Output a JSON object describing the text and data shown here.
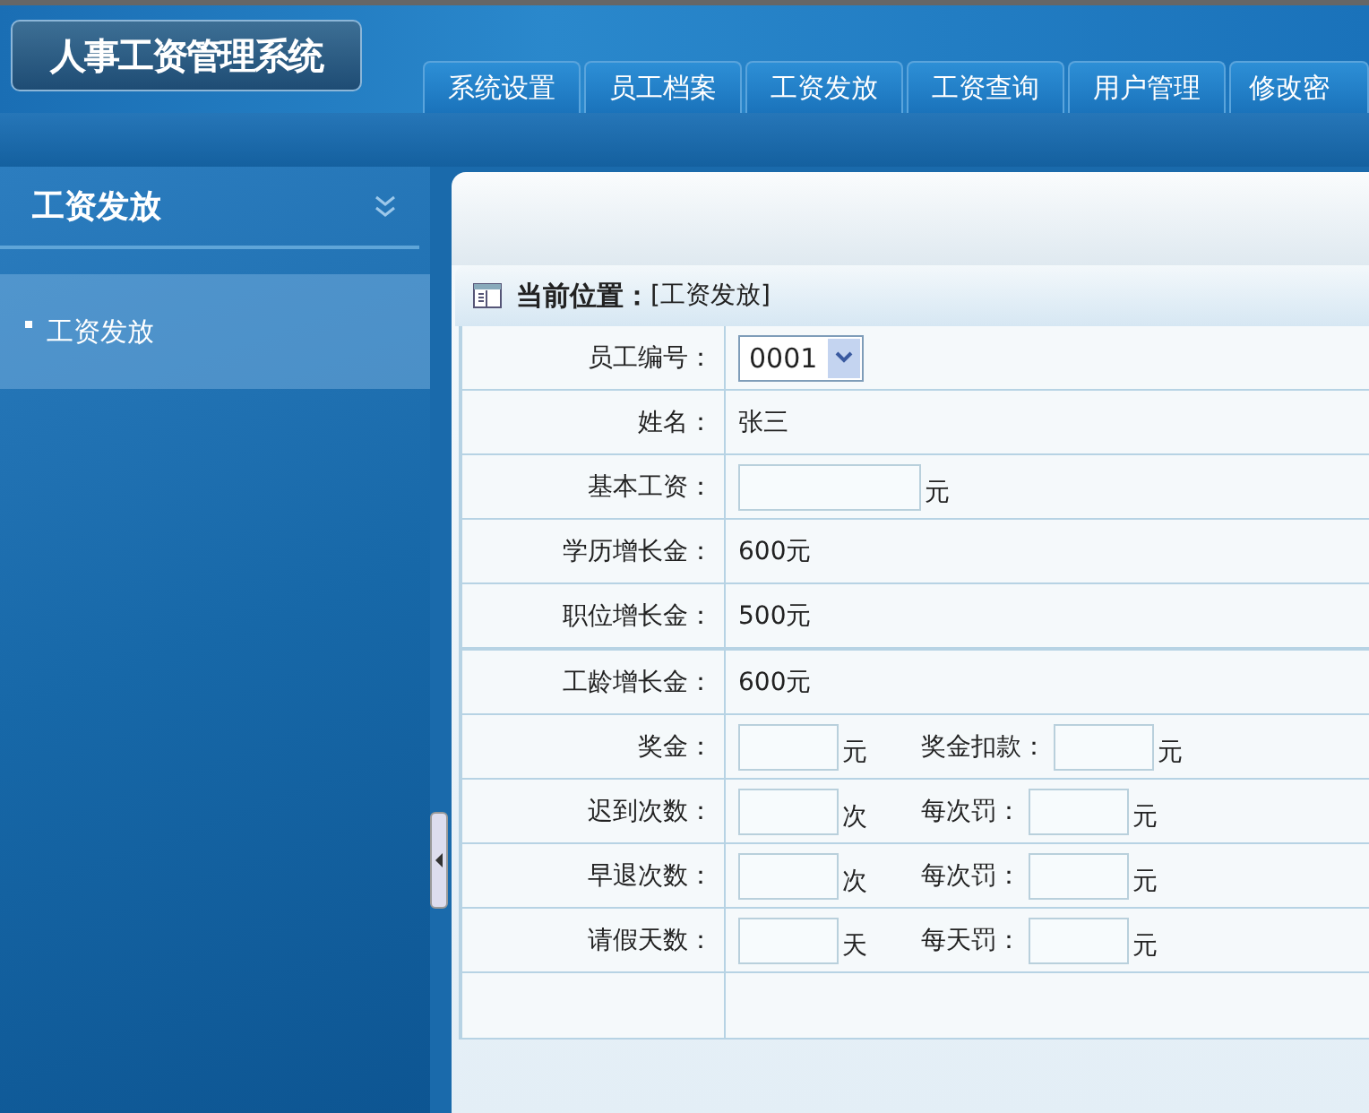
{
  "header": {
    "logo": "人事工资管理系统"
  },
  "tabs": [
    {
      "label": "系统设置",
      "selected": false
    },
    {
      "label": "员工档案",
      "selected": false
    },
    {
      "label": "工资发放",
      "selected": false
    },
    {
      "label": "工资查询",
      "selected": false
    },
    {
      "label": "用户管理",
      "selected": false
    },
    {
      "label": "修改密",
      "selected": false
    }
  ],
  "sidebar": {
    "title": "工资发放",
    "items": [
      {
        "label": "工资发放",
        "selected": true
      }
    ]
  },
  "breadcrumb": {
    "label": "当前位置：",
    "value": "[工资发放]"
  },
  "form": {
    "rows": [
      {
        "kind": "select",
        "label": "员工编号：",
        "value": "0001"
      },
      {
        "kind": "text",
        "label": "姓名：",
        "value": "张三"
      },
      {
        "kind": "input",
        "label": "基本工资：",
        "unit": "元"
      },
      {
        "kind": "text",
        "label": "学历增长金：",
        "value": "600元"
      },
      {
        "kind": "text",
        "label": "职位增长金：",
        "value": "500元"
      },
      {
        "kind": "text",
        "label": "工龄增长金：",
        "value": "600元"
      },
      {
        "kind": "pair",
        "label": "奖金：",
        "unit": "元",
        "label2": "奖金扣款：",
        "unit2": "元"
      },
      {
        "kind": "pair",
        "label": "迟到次数：",
        "unit": "次",
        "label2": "每次罚：",
        "unit2": "元"
      },
      {
        "kind": "pair",
        "label": "早退次数：",
        "unit": "次",
        "label2": "每次罚：",
        "unit2": "元"
      },
      {
        "kind": "pair",
        "label": "请假天数：",
        "unit": "天",
        "label2": "每天罚：",
        "unit2": "元"
      }
    ]
  }
}
